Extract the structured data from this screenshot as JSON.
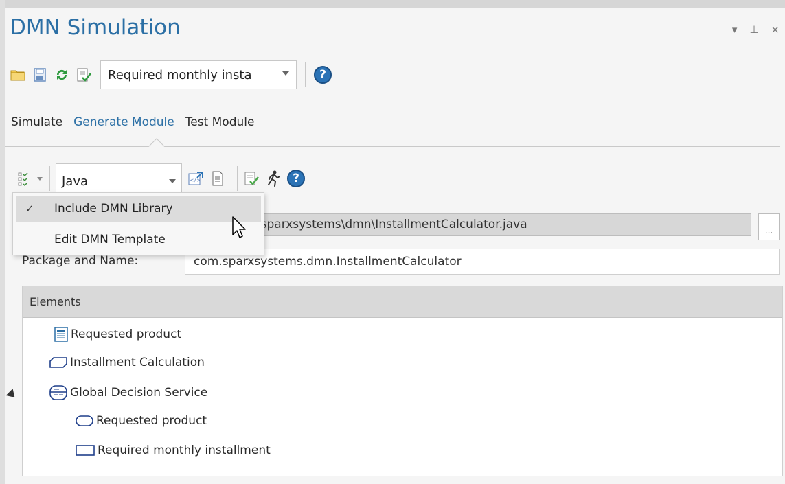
{
  "window": {
    "title": "DMN Simulation",
    "controls": {
      "dropdown": "▾",
      "pin": "⊥",
      "close": "×"
    }
  },
  "toolbar": {
    "model_select": "Required monthly insta",
    "help_label": "?"
  },
  "tabs": [
    {
      "label": "Simulate",
      "active": false
    },
    {
      "label": "Generate Module",
      "active": true
    },
    {
      "label": "Test Module",
      "active": false
    }
  ],
  "generate": {
    "language": "Java",
    "help_label": "?",
    "file_path": "kageB\\com\\sparxsystems\\dmn\\InstallmentCalculator.java",
    "browse_label": "...",
    "package_label": "Package and Name:",
    "package_value": "com.sparxsystems.dmn.InstallmentCalculator"
  },
  "options_menu": {
    "items": [
      {
        "label": "Include DMN Library",
        "checked": true,
        "check_mark": "✓"
      },
      {
        "label": "Edit DMN Template",
        "checked": false,
        "check_mark": ""
      }
    ]
  },
  "elements": {
    "header": "Elements",
    "items": [
      {
        "label": "Requested product",
        "icon": "input-data-icon"
      },
      {
        "label": "Installment Calculation",
        "icon": "bkm-icon"
      },
      {
        "label": "Global Decision Service",
        "icon": "decision-service-icon",
        "expanded": true
      },
      {
        "label": "Requested product",
        "icon": "input-data-icon"
      },
      {
        "label": "Required monthly installment",
        "icon": "decision-icon"
      }
    ]
  },
  "colors": {
    "accent": "#2b6fa5",
    "help_blue": "#2b73b6",
    "menu_highlight": "#dcdcdc"
  }
}
